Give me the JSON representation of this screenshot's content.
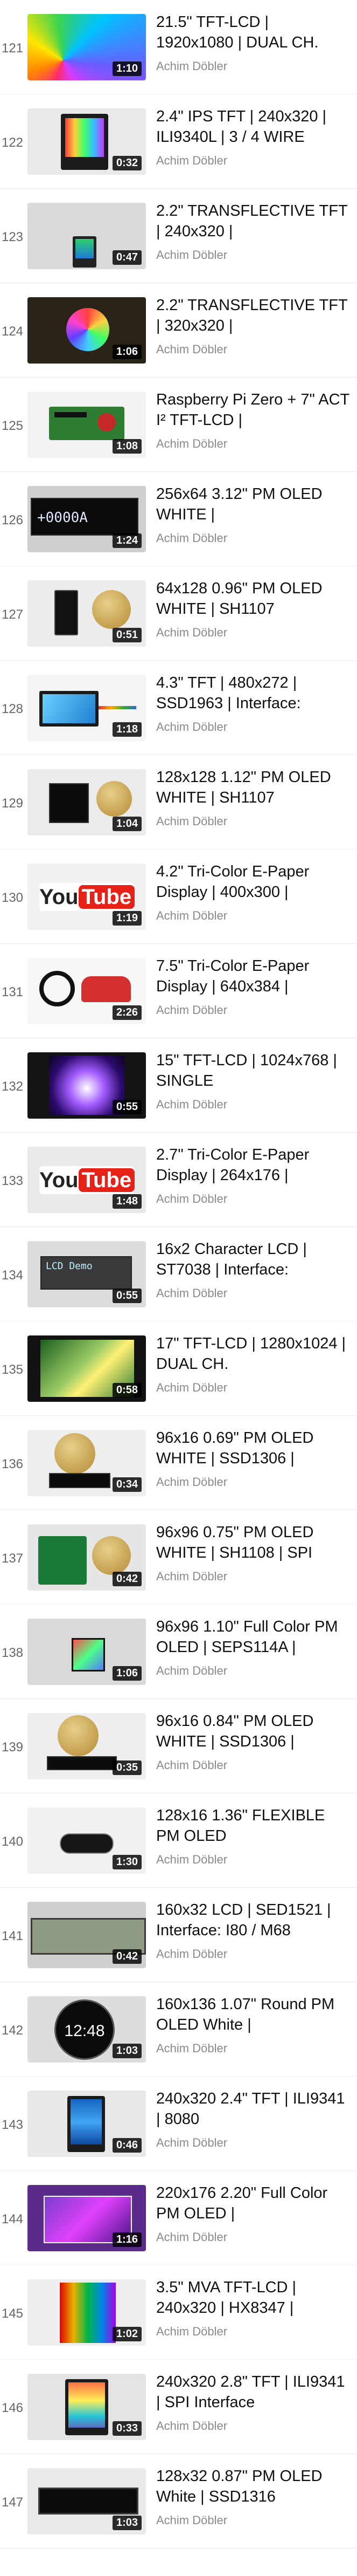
{
  "playlist": {
    "channel": "Achim Döbler",
    "items": [
      {
        "index": "121",
        "title": "21.5\" TFT-LCD | 1920x1080 | DUAL CH.",
        "duration": "1:10"
      },
      {
        "index": "122",
        "title": "2.4\" IPS TFT | 240x320 | ILI9340L | 3 / 4 WIRE",
        "duration": "0:32"
      },
      {
        "index": "123",
        "title": "2.2\" TRANSFLECTIVE TFT | 240x320 |",
        "duration": "0:47"
      },
      {
        "index": "124",
        "title": "2.2\" TRANSFLECTIVE TFT | 320x320 |",
        "duration": "1:06"
      },
      {
        "index": "125",
        "title": "Raspberry Pi Zero + 7\" ACT I² TFT-LCD |",
        "duration": "1:08"
      },
      {
        "index": "126",
        "title": "256x64 3.12\" PM OLED WHITE |",
        "duration": "1:24"
      },
      {
        "index": "127",
        "title": "64x128 0.96\" PM OLED WHITE | SH1107",
        "duration": "0:51"
      },
      {
        "index": "128",
        "title": "4.3\" TFT | 480x272 | SSD1963 | Interface:",
        "duration": "1:18"
      },
      {
        "index": "129",
        "title": "128x128 1.12\" PM OLED WHITE | SH1107",
        "duration": "1:04"
      },
      {
        "index": "130",
        "title": "4.2\" Tri-Color E-Paper Display | 400x300 |",
        "duration": "1:19"
      },
      {
        "index": "131",
        "title": "7.5\" Tri-Color E-Paper Display | 640x384 |",
        "duration": "2:26"
      },
      {
        "index": "132",
        "title": "15\" TFT-LCD | 1024x768 | SINGLE",
        "duration": "0:55"
      },
      {
        "index": "133",
        "title": "2.7\" Tri-Color E-Paper Display | 264x176 |",
        "duration": "1:48"
      },
      {
        "index": "134",
        "title": "16x2 Character LCD | ST7038 | Interface:",
        "duration": "0:55"
      },
      {
        "index": "135",
        "title": "17\" TFT-LCD | 1280x1024 | DUAL CH.",
        "duration": "0:58"
      },
      {
        "index": "136",
        "title": "96x16 0.69\" PM OLED WHITE | SSD1306 |",
        "duration": "0:34"
      },
      {
        "index": "137",
        "title": "96x96 0.75\" PM OLED WHITE | SH1108 | SPI",
        "duration": "0:42"
      },
      {
        "index": "138",
        "title": "96x96 1.10\" Full Color PM OLED | SEPS114A |",
        "duration": "1:06"
      },
      {
        "index": "139",
        "title": "96x16 0.84\" PM OLED WHITE | SSD1306 |",
        "duration": "0:35"
      },
      {
        "index": "140",
        "title": "128x16 1.36\" FLEXIBLE PM OLED",
        "duration": "1:30"
      },
      {
        "index": "141",
        "title": "160x32 LCD | SED1521 | Interface: I80 / M68",
        "duration": "0:42"
      },
      {
        "index": "142",
        "title": "160x136 1.07\" Round PM OLED White |",
        "duration": "1:03"
      },
      {
        "index": "143",
        "title": "240x320 2.4\" TFT | ILI9341 | 8080",
        "duration": "0:46"
      },
      {
        "index": "144",
        "title": "220x176 2.20\" Full Color PM OLED |",
        "duration": "1:16"
      },
      {
        "index": "145",
        "title": "3.5\" MVA TFT-LCD | 240x320 | HX8347 |",
        "duration": "1:02"
      },
      {
        "index": "146",
        "title": "240x320 2.8\" TFT | ILI9341 | SPI Interface",
        "duration": "0:33"
      },
      {
        "index": "147",
        "title": "128x32 0.87\" PM OLED White | SSD1316",
        "duration": "1:03"
      }
    ],
    "thumb_text": {
      "youtube_you": "You",
      "youtube_tube": "Tube",
      "oled_readout": "+0000A",
      "lcd_line1": "LCD Demo",
      "clock": "12:48"
    }
  }
}
